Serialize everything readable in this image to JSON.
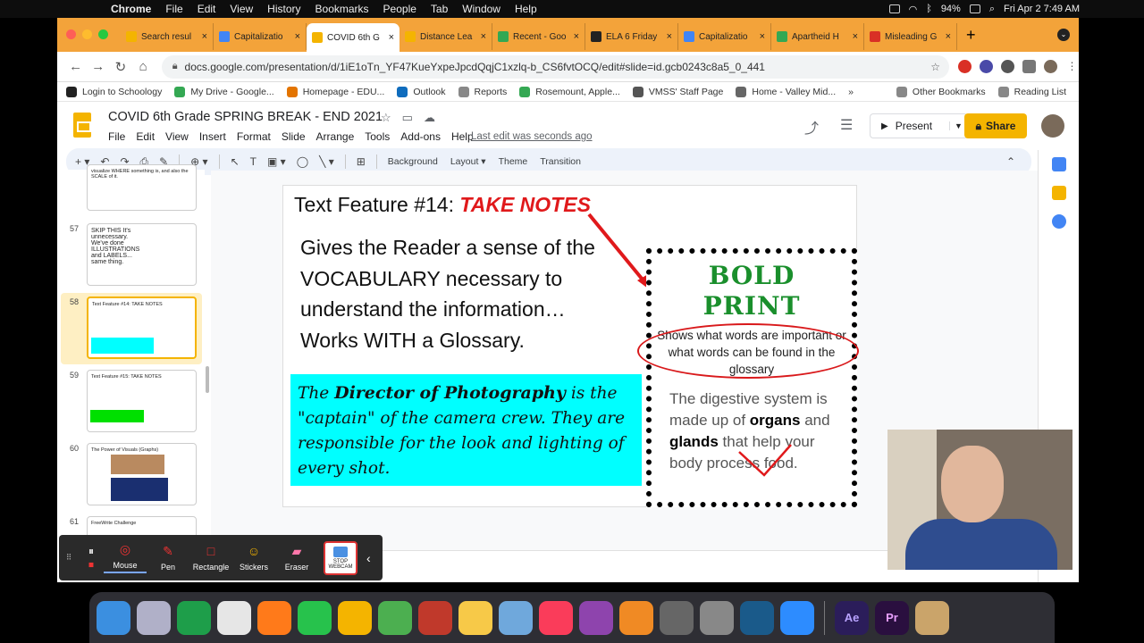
{
  "menubar": {
    "app_name": "Chrome",
    "items": [
      "File",
      "Edit",
      "View",
      "History",
      "Bookmarks",
      "People",
      "Tab",
      "Window",
      "Help"
    ],
    "battery": "94%",
    "datetime": "Fri Apr 2  7:49 AM"
  },
  "tabs": [
    {
      "title": "Search resul",
      "color": "#f4b400",
      "active": false
    },
    {
      "title": "Capitalizatio",
      "color": "#4285f4",
      "active": false
    },
    {
      "title": "COVID 6th G",
      "color": "#f4b400",
      "active": true
    },
    {
      "title": "Distance Lea",
      "color": "#f4b400",
      "active": false
    },
    {
      "title": "Recent - Goo",
      "color": "#34a853",
      "active": false
    },
    {
      "title": "ELA 6 Friday",
      "color": "#222222",
      "active": false
    },
    {
      "title": "Capitalizatio",
      "color": "#4285f4",
      "active": false
    },
    {
      "title": "Apartheid H",
      "color": "#34a853",
      "active": false
    },
    {
      "title": "Misleading G",
      "color": "#d93025",
      "active": false
    }
  ],
  "omnibox": {
    "url": "docs.google.com/presentation/d/1iE1oTn_YF47KueYxpeJpcdQqjC1xzlq-b_CS6fvtOCQ/edit#slide=id.gcb0243c8a5_0_441"
  },
  "bookmarks": [
    {
      "label": "Login to Schoology",
      "color": "#222222"
    },
    {
      "label": "My Drive - Google...",
      "color": "#34a853"
    },
    {
      "label": "Homepage - EDU...",
      "color": "#e37400"
    },
    {
      "label": "Outlook",
      "color": "#0f6cbd"
    },
    {
      "label": "Reports",
      "color": "#888888"
    },
    {
      "label": "Rosemount, Apple...",
      "color": "#34a853"
    },
    {
      "label": "VMSS' Staff Page",
      "color": "#555555"
    },
    {
      "label": "Home - Valley Mid...",
      "color": "#666666"
    }
  ],
  "bookmarks_more": "»",
  "other_bookmarks": "Other Bookmarks",
  "reading_list": "Reading List",
  "doc": {
    "title": "COVID 6th Grade SPRING BREAK - END 2021",
    "menu": [
      "File",
      "Edit",
      "View",
      "Insert",
      "Format",
      "Slide",
      "Arrange",
      "Tools",
      "Add-ons",
      "Help"
    ],
    "last_edit": "Last edit was seconds ago",
    "present_label": "Present",
    "share_label": "Share"
  },
  "slide_toolbar": {
    "background": "Background",
    "layout": "Layout",
    "theme": "Theme",
    "transition": "Transition"
  },
  "filmstrip": [
    {
      "num": "",
      "text": "visualize WHERE something is, and also the SCALE of it."
    },
    {
      "num": "57",
      "text": "SKIP THIS It's unnecessary. We've done ILLUSTRATIONS and LABELS... same thing."
    },
    {
      "num": "58",
      "text": "Text Feature #14: TAKE NOTES"
    },
    {
      "num": "59",
      "text": "Text Feature #15: TAKE NOTES"
    },
    {
      "num": "60",
      "text": "The Power of Visuals (Graphs)"
    },
    {
      "num": "61",
      "text": "FreeWrite Challenge"
    }
  ],
  "slide": {
    "title_prefix": "Text Feature #14: ",
    "title_emph": "TAKE NOTES",
    "body_lines": [
      "Gives the Reader a sense of the",
      "VOCABULARY necessary to",
      "understand the information…",
      "Works WITH a Glossary."
    ],
    "example_parts": {
      "p1": "The ",
      "b1": "Director of Photography",
      "p2": " is the \"captain\" of the camera crew. They are responsible for the look and lighting of every shot."
    },
    "card_title_1": "BOLD",
    "card_title_2": "PRINT",
    "card_desc": "Shows what words are important or what words can be found in the glossary",
    "card_example": {
      "p1": "The digestive system is made up of ",
      "b1": "organs",
      "p2": " and ",
      "b2": "glands",
      "p3": " that help your body process food."
    }
  },
  "annotation_toolbar": {
    "items": [
      {
        "label": "Mouse",
        "icon": "mouse-icon"
      },
      {
        "label": "Pen",
        "icon": "pen-icon"
      },
      {
        "label": "Rectangle",
        "icon": "rectangle-icon"
      },
      {
        "label": "Stickers",
        "icon": "sticker-icon"
      },
      {
        "label": "Eraser",
        "icon": "eraser-icon"
      }
    ],
    "webcam_label_1": "STOP",
    "webcam_label_2": "WEBCAM"
  },
  "dock_apps": [
    "Finder",
    "Launchpad",
    "Google Drive",
    "Chrome",
    "Firefox",
    "FaceTime",
    "Google Slides",
    "Maps",
    "Photo Booth",
    "Photos",
    "Preview",
    "Music",
    "Podcasts",
    "Blender",
    "Calculator",
    "System Preferences",
    "QuickTime",
    "Zoom",
    "Ae",
    "Pr",
    "Pencil"
  ],
  "colors": {
    "tab_strip": "#f3a33a",
    "accent_yellow": "#f4b400",
    "highlight_cyan": "#00ffff",
    "title_red": "#e0191b",
    "bold_print_green": "#1a8f2c"
  }
}
